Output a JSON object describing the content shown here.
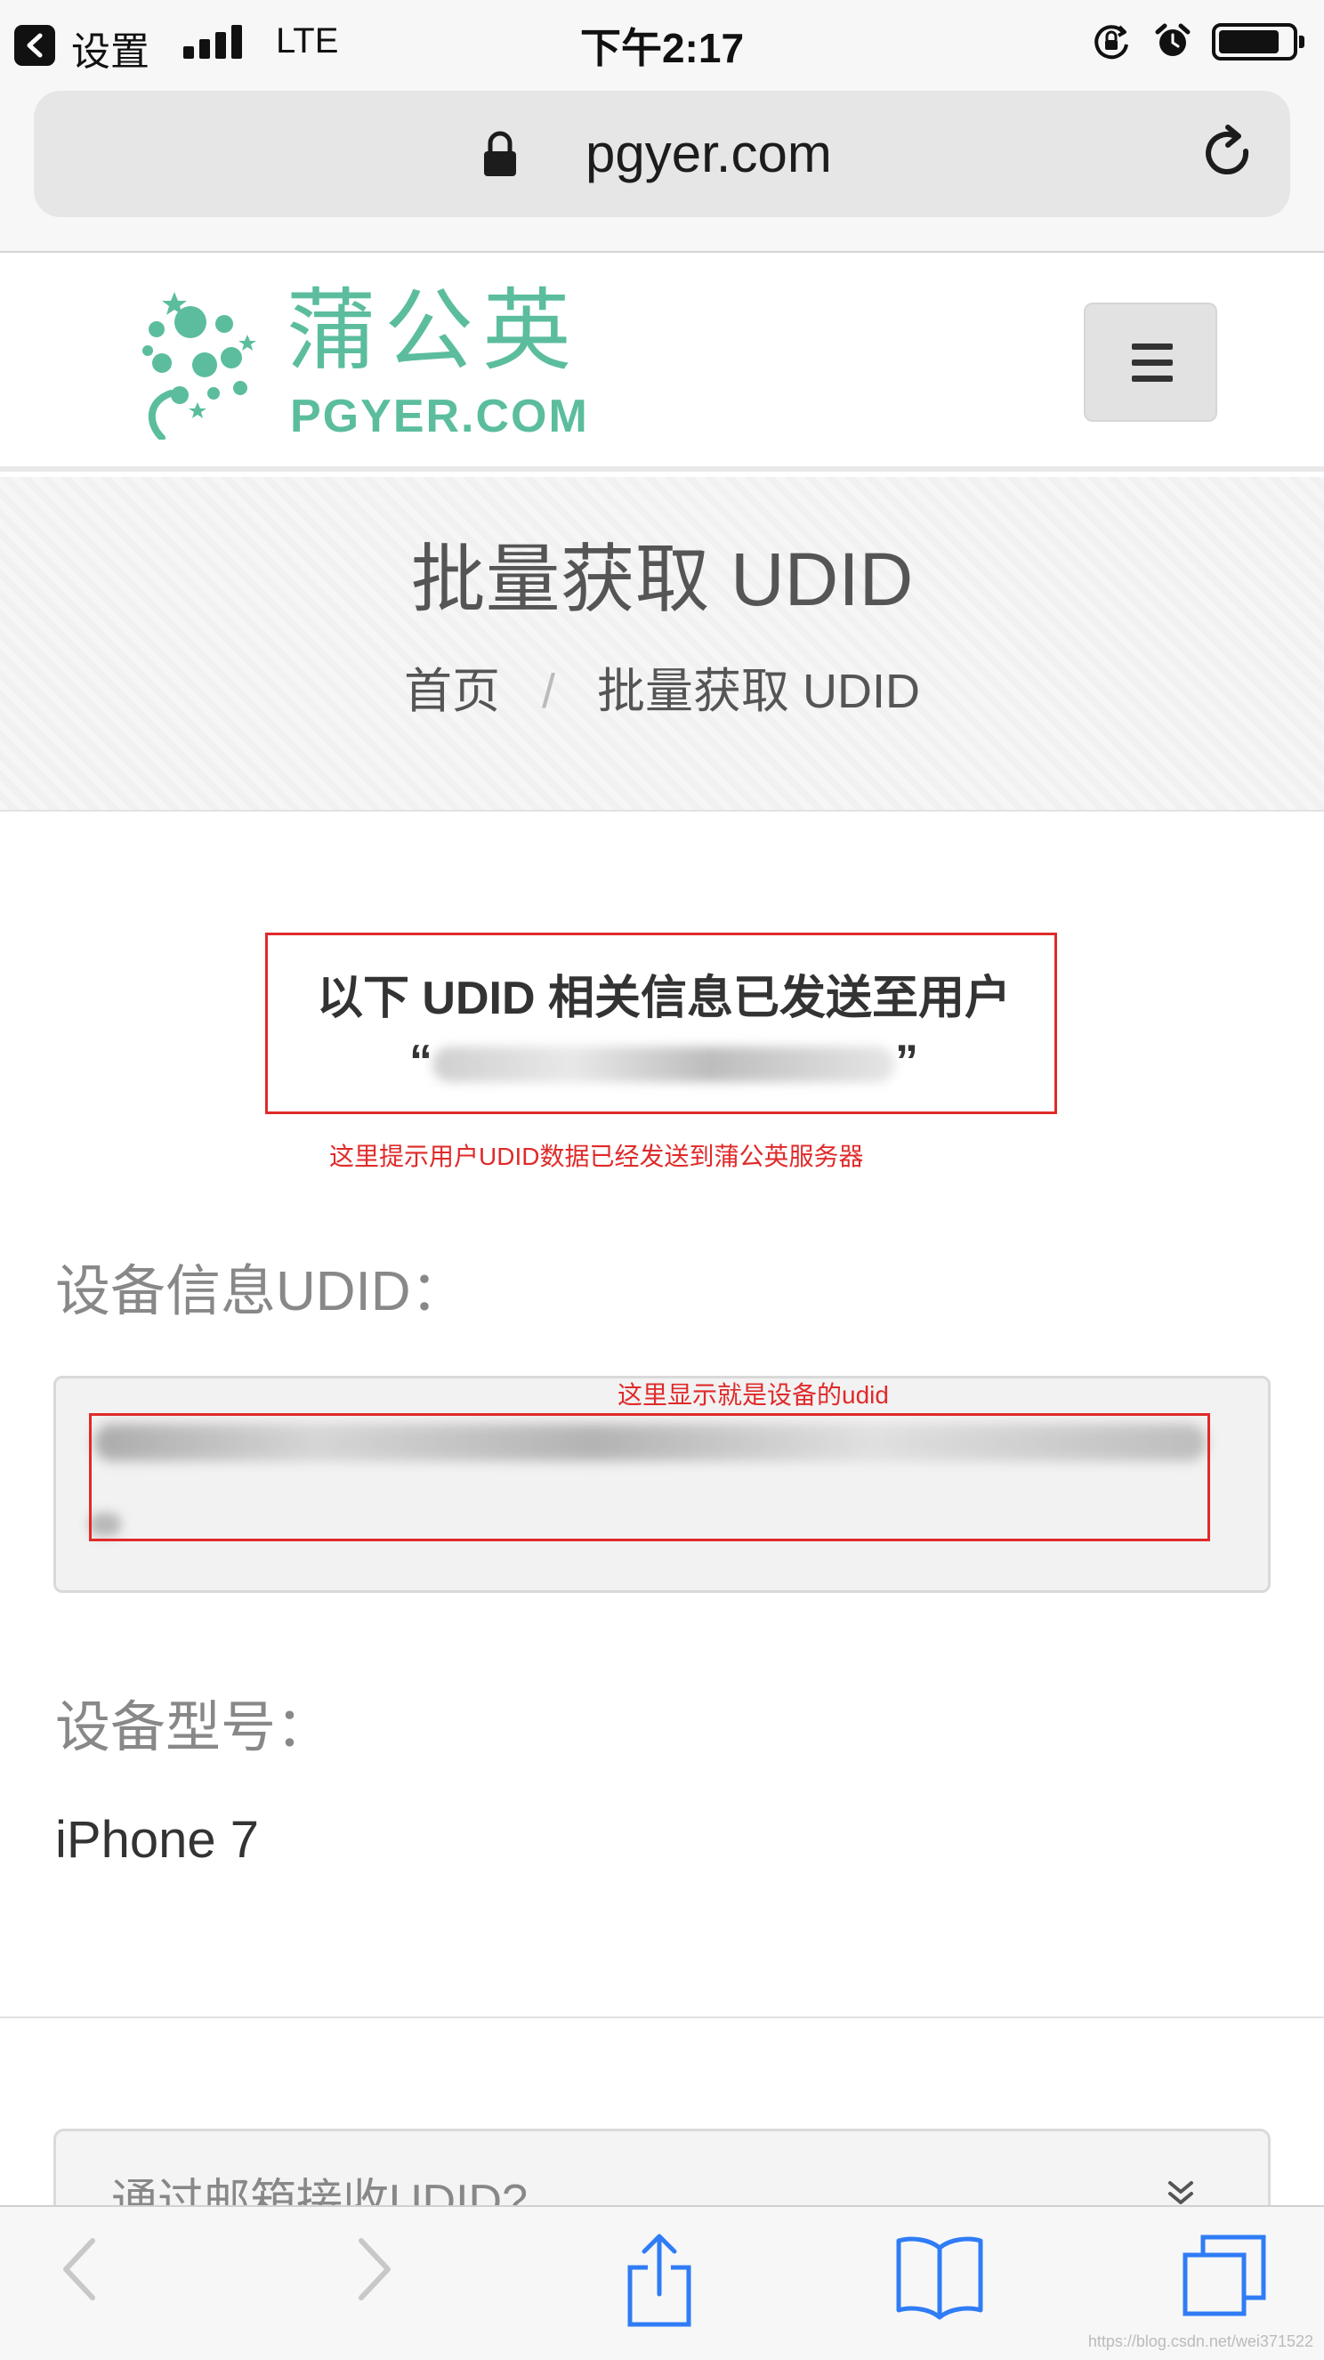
{
  "status_bar": {
    "back_app": "设置",
    "network": "LTE",
    "time": "下午2:17",
    "battery_level": 0.85
  },
  "address_bar": {
    "url": "pgyer.com"
  },
  "site_header": {
    "logo_text_cn": "蒲公英",
    "logo_text_en": "PGYER.COM",
    "brand_color": "#5bbd9e"
  },
  "title_band": {
    "title": "批量获取 UDID",
    "breadcrumb": {
      "home": "首页",
      "separator": "/",
      "current": "批量获取 UDID"
    }
  },
  "content": {
    "sent_message": "以下 UDID 相关信息已发送至用户",
    "open_quote": "“",
    "close_quote": "”",
    "annotation_sent": "这里提示用户UDID数据已经发送到蒲公英服务器",
    "udid_label": "设备信息UDID：",
    "annotation_udid": "这里显示就是设备的udid",
    "model_label": "设备型号：",
    "model_value": "iPhone 7",
    "email_panel_label": "通过邮箱接收UDID?"
  },
  "watermark": "https://blog.csdn.net/wei371522",
  "colors": {
    "annotation_red": "#e02a2a",
    "ios_blue": "#2f7cf6"
  }
}
